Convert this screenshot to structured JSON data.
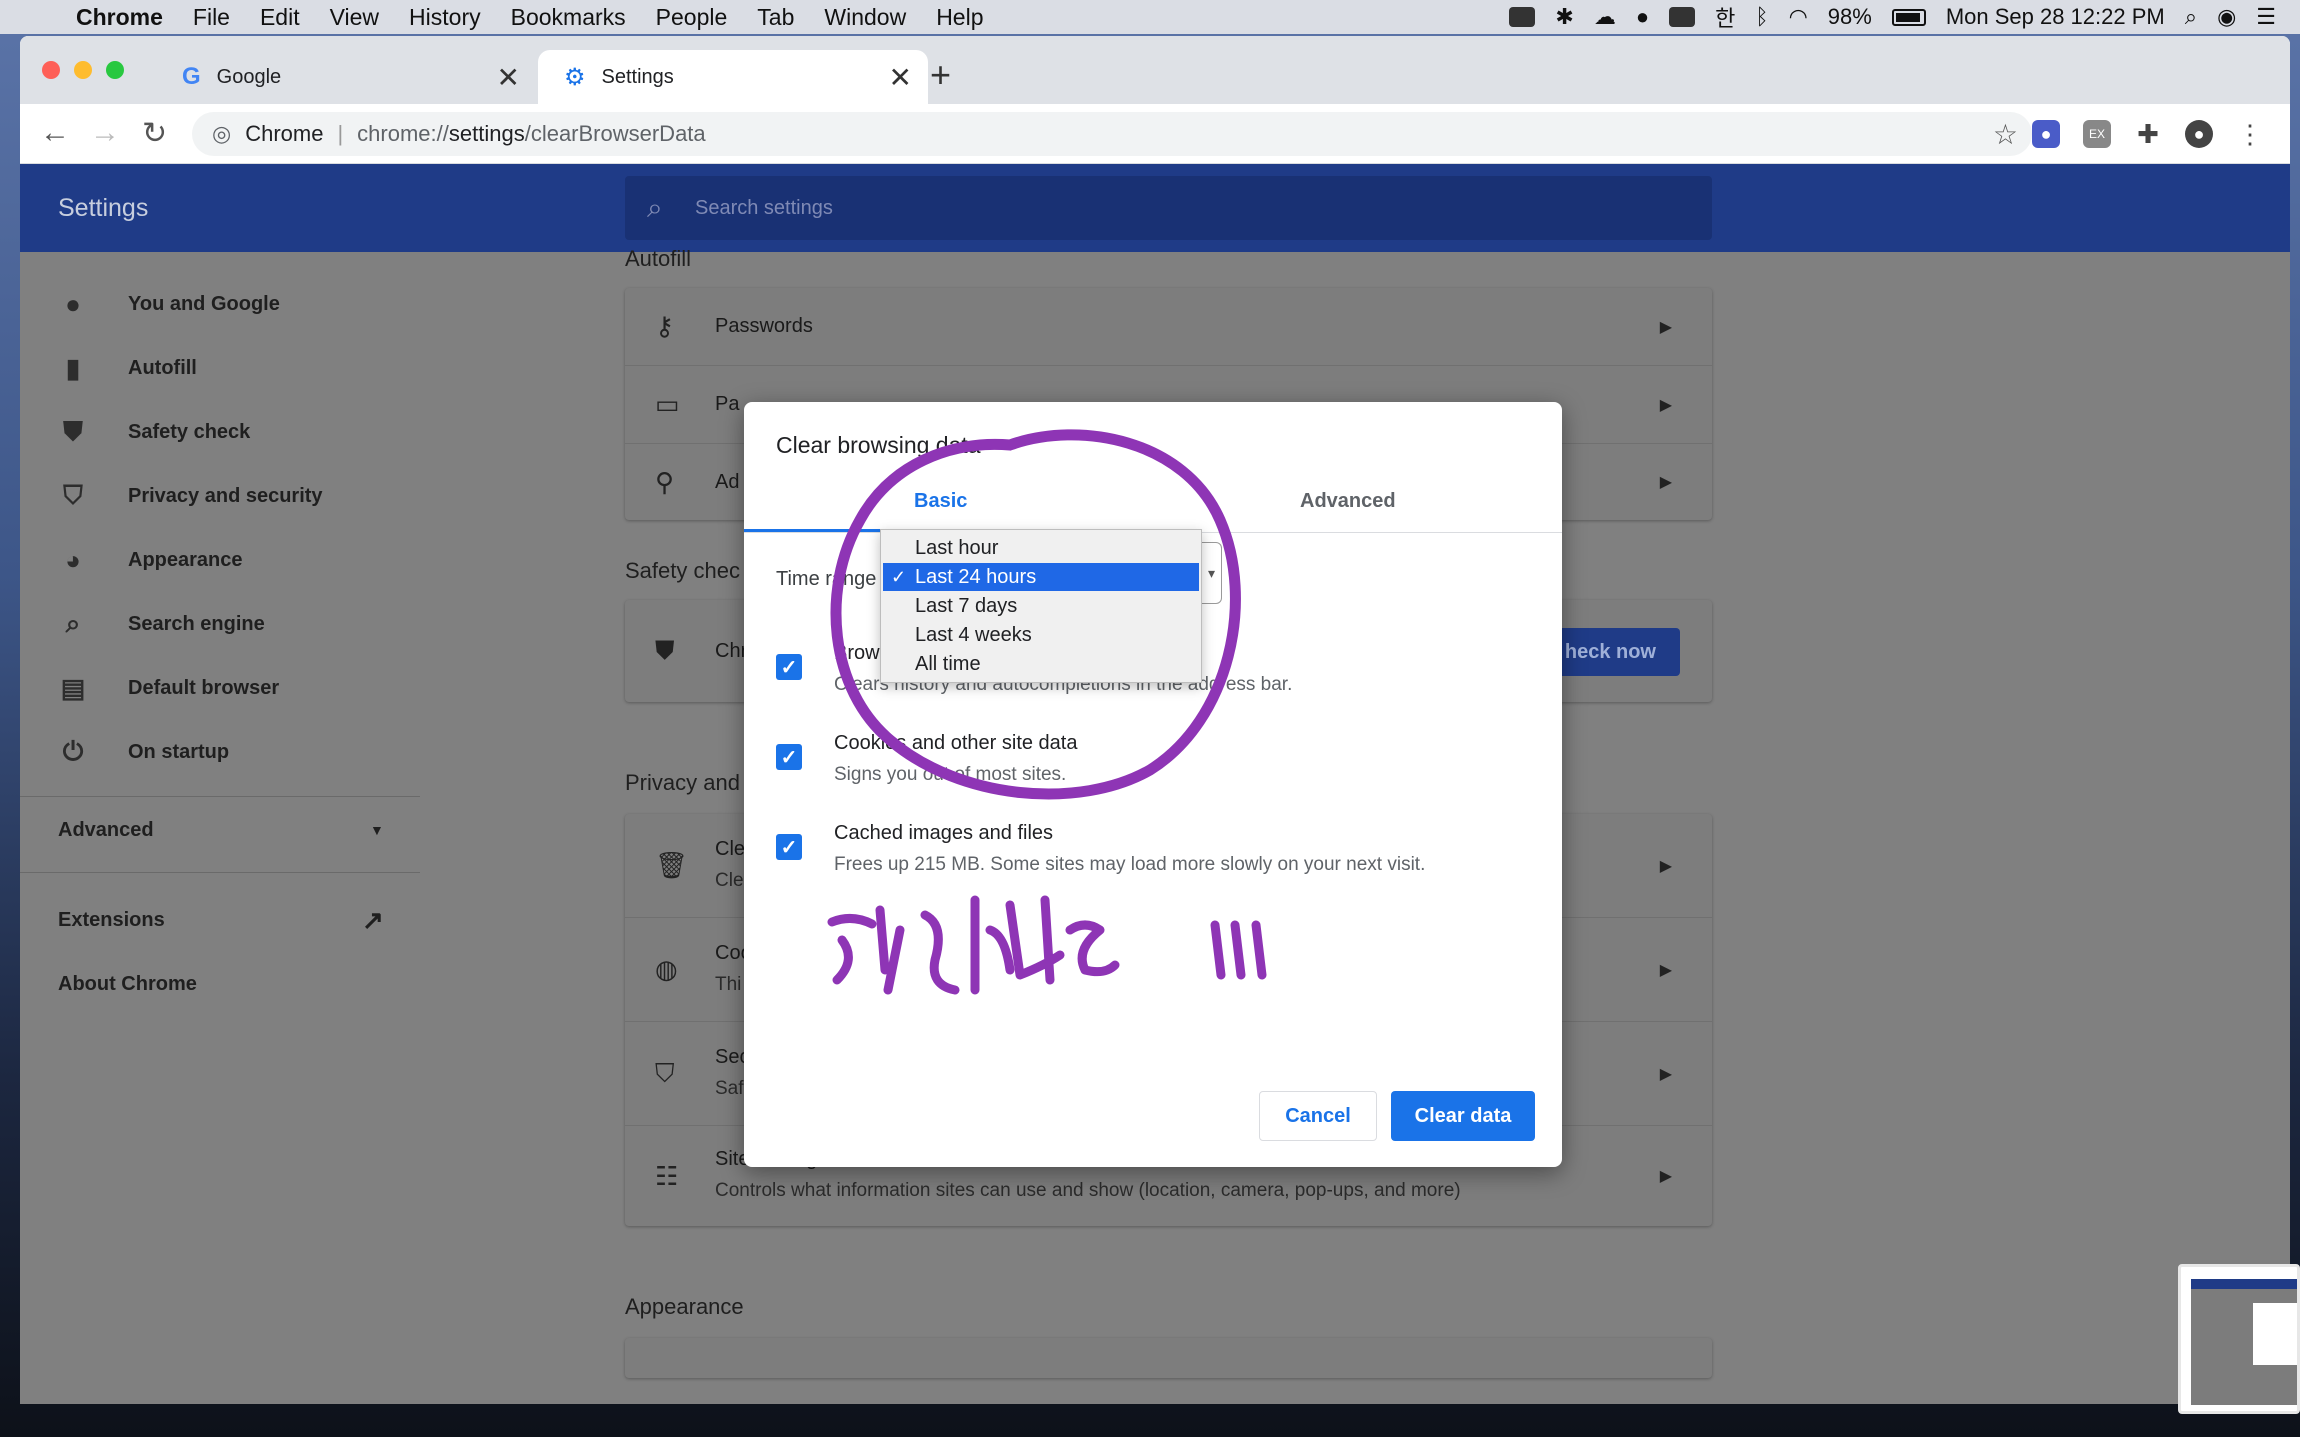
{
  "menubar": {
    "app": "Chrome",
    "items": [
      "File",
      "Edit",
      "View",
      "History",
      "Bookmarks",
      "People",
      "Tab",
      "Window",
      "Help"
    ],
    "battery": "98%",
    "clock": "Mon Sep 28  12:22 PM"
  },
  "tabs": [
    {
      "title": "Google",
      "icon": "google-g-icon"
    },
    {
      "title": "Settings",
      "icon": "gear-icon"
    }
  ],
  "omnibox": {
    "site": "Chrome",
    "url_prefix": "chrome://",
    "url_host": "settings",
    "url_path": "/clearBrowserData"
  },
  "settings": {
    "title": "Settings",
    "search_placeholder": "Search settings",
    "nav": [
      {
        "label": "You and Google",
        "icon": "person-icon"
      },
      {
        "label": "Autofill",
        "icon": "clipboard-icon"
      },
      {
        "label": "Safety check",
        "icon": "shield-check-icon"
      },
      {
        "label": "Privacy and security",
        "icon": "shield-icon"
      },
      {
        "label": "Appearance",
        "icon": "palette-icon"
      },
      {
        "label": "Search engine",
        "icon": "search-icon"
      },
      {
        "label": "Default browser",
        "icon": "browser-icon"
      },
      {
        "label": "On startup",
        "icon": "power-icon"
      }
    ],
    "advanced": "Advanced",
    "extensions": "Extensions",
    "about": "About Chrome"
  },
  "content": {
    "autofill_head": "Autofill",
    "autofill_rows": [
      "Passwords",
      "Pa",
      "Ad"
    ],
    "safety_head": "Safety chec",
    "safety_row": "Chr",
    "check_now": "heck now",
    "privacy_head": "Privacy and",
    "privacy_rows": [
      {
        "title": "Cle",
        "sub": "Cle"
      },
      {
        "title": "Coo",
        "sub": "Thi"
      },
      {
        "title": "Sec",
        "sub": "Saf"
      },
      {
        "title": "Site Settings",
        "sub": "Controls what information sites can use and show (location, camera, pop-ups, and more)"
      }
    ],
    "appearance_head": "Appearance"
  },
  "dialog": {
    "title": "Clear browsing data",
    "tab_basic": "Basic",
    "tab_advanced": "Advanced",
    "time_range_label": "Time range",
    "time_options": [
      "Last hour",
      "Last 24 hours",
      "Last 7 days",
      "Last 4 weeks",
      "All time"
    ],
    "selected_option": "Last 24 hours",
    "items": [
      {
        "title": "Brow",
        "sub": "Clears history and autocompletions in the address bar."
      },
      {
        "title": "Cookies and other site data",
        "sub": "Signs you out of most sites."
      },
      {
        "title": "Cached images and files",
        "sub": "Frees up 215 MB. Some sites may load more slowly on your next visit."
      }
    ],
    "cancel": "Cancel",
    "clear": "Clear data"
  },
  "colors": {
    "accent": "#1a73e8",
    "header": "#1f3b87",
    "annotation": "#8e35b5"
  }
}
